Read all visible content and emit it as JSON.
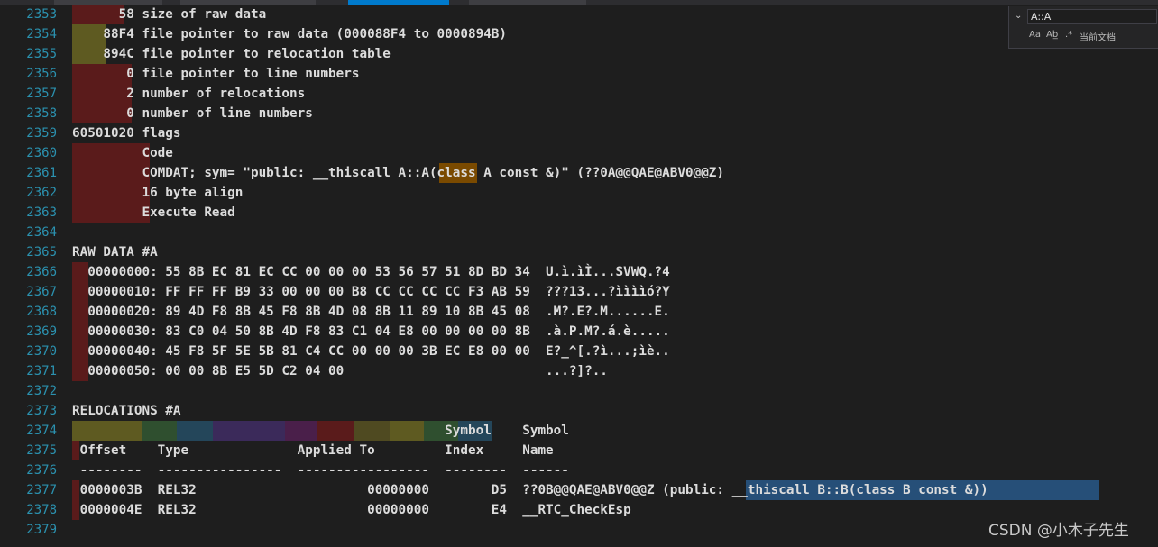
{
  "editor": {
    "lines": [
      {
        "n": "2353",
        "text": "      58 size of raw data"
      },
      {
        "n": "2354",
        "text": "    88F4 file pointer to raw data (000088F4 to 0000894B)"
      },
      {
        "n": "2355",
        "text": "    894C file pointer to relocation table"
      },
      {
        "n": "2356",
        "text": "       0 file pointer to line numbers"
      },
      {
        "n": "2357",
        "text": "       2 number of relocations"
      },
      {
        "n": "2358",
        "text": "       0 number of line numbers"
      },
      {
        "n": "2359",
        "text": "60501020 flags"
      },
      {
        "n": "2360",
        "text": "         Code"
      },
      {
        "n": "2361",
        "text": "         COMDAT; sym= \"public: __thiscall A::A(class A const &)\" (??0A@@QAE@ABV0@@Z)"
      },
      {
        "n": "2362",
        "text": "         16 byte align"
      },
      {
        "n": "2363",
        "text": "         Execute Read"
      },
      {
        "n": "2364",
        "text": ""
      },
      {
        "n": "2365",
        "text": "RAW DATA #A"
      },
      {
        "n": "2366",
        "text": "  00000000: 55 8B EC 81 EC CC 00 00 00 53 56 57 51 8D BD 34  U.ì.ìÌ...SVWQ.?4"
      },
      {
        "n": "2367",
        "text": "  00000010: FF FF FF B9 33 00 00 00 B8 CC CC CC CC F3 AB 59  ???13...?ììììó?Y"
      },
      {
        "n": "2368",
        "text": "  00000020: 89 4D F8 8B 45 F8 8B 4D 08 8B 11 89 10 8B 45 08  .M?.E?.M......E."
      },
      {
        "n": "2369",
        "text": "  00000030: 83 C0 04 50 8B 4D F8 83 C1 04 E8 00 00 00 00 8B  .à.P.M?.á.è....."
      },
      {
        "n": "2370",
        "text": "  00000040: 45 F8 5F 5E 5B 81 C4 CC 00 00 00 3B EC E8 00 00  E?_^[.?ì...;ìè.."
      },
      {
        "n": "2371",
        "text": "  00000050: 00 00 8B E5 5D C2 04 00                          ...?]?.."
      },
      {
        "n": "2372",
        "text": ""
      },
      {
        "n": "2373",
        "text": "RELOCATIONS #A"
      },
      {
        "n": "2374",
        "text": "                                                Symbol    Symbol"
      },
      {
        "n": "2375",
        "text": " Offset    Type              Applied To         Index     Name"
      },
      {
        "n": "2376",
        "text": " --------  ----------------  -----------------  --------  ------"
      },
      {
        "n": "2377",
        "text": " 0000003B  REL32                      00000000        D5  ??0B@@QAE@ABV0@@Z (public: __thiscall B::B(class B const &))"
      },
      {
        "n": "2378",
        "text": " 0000004E  REL32                      00000000        E4  __RTC_CheckEsp"
      },
      {
        "n": "2379",
        "text": ""
      }
    ]
  },
  "find_widget": {
    "query": "A::A",
    "opt_case": "Aa",
    "opt_word": "Ab̲",
    "opt_regex": ".*",
    "scope": "当前文档"
  },
  "watermark": "CSDN @小木子先生",
  "colors": {
    "background": "#1e1e1e",
    "line_number": "#2b91af",
    "text": "#dcdcdc",
    "find_match": "#7a4a00",
    "selection": "#264f78",
    "marker_red": "#5a1b1b",
    "marker_olive": "#5e5a21"
  }
}
